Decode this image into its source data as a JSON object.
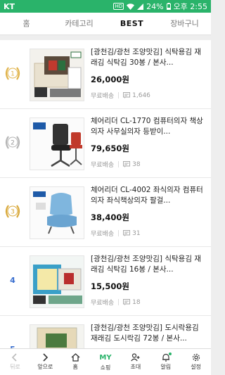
{
  "status": {
    "carrier": "KT",
    "hd": "HD",
    "battery": "24%",
    "time": "오후 2:55"
  },
  "tabs": [
    {
      "label": "홈"
    },
    {
      "label": "카테고리"
    },
    {
      "label": "BEST"
    },
    {
      "label": "장바구니"
    }
  ],
  "products": [
    {
      "rank": "1",
      "title": "[광천김/광천 조양맛김] 식탁용김 재래김 식탁김 30봉 / 본사...",
      "price": "26,000원",
      "shipping": "무료배송",
      "reviews": "1,646"
    },
    {
      "rank": "2",
      "title": "체어리더 CL-1770 컴퓨터의자 책상의자 사무실의자 등받이...",
      "price": "79,650원",
      "shipping": "무료배송",
      "reviews": "38"
    },
    {
      "rank": "3",
      "title": "체어리더 CL-4002 좌식의자 컴퓨터의자 좌식책상의자 팔걸...",
      "price": "38,400원",
      "shipping": "무료배송",
      "reviews": "31"
    },
    {
      "rank": "4",
      "title": "[광천김/광천 조양맛김] 식탁용김 재래김 식탁김 16봉 / 본사...",
      "price": "15,500원",
      "shipping": "무료배송",
      "reviews": "18"
    },
    {
      "rank": "5",
      "title": "[광천김/광천 조양맛김] 도시락용김 재래김 도시락김 72봉 / 본사...",
      "price": "",
      "shipping": "",
      "reviews": ""
    }
  ],
  "bottom_nav": [
    {
      "label": "뒤로",
      "icon": "back-icon"
    },
    {
      "label": "앞으로",
      "icon": "forward-icon"
    },
    {
      "label": "홈",
      "icon": "home-icon"
    },
    {
      "label": "쇼핑",
      "icon": "my-icon",
      "badge": "MY"
    },
    {
      "label": "초대",
      "icon": "add-person-icon"
    },
    {
      "label": "알림",
      "icon": "bell-icon"
    },
    {
      "label": "설정",
      "icon": "gear-icon"
    }
  ],
  "colors": {
    "accent": "#2ab36a",
    "rank_blue": "#3a6fcf",
    "medal": "#d9a93b"
  }
}
